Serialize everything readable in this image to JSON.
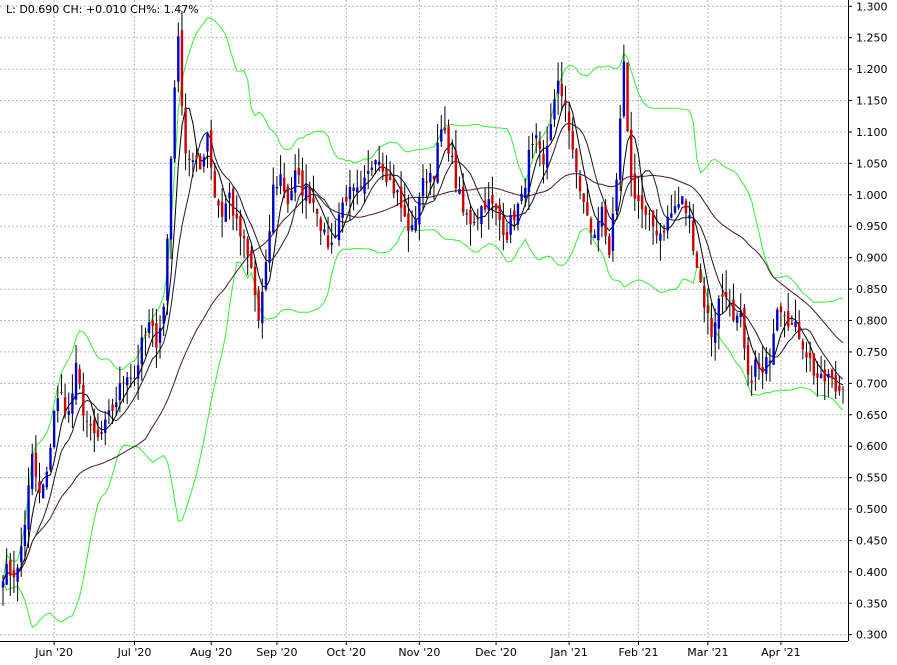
{
  "info_bar": {
    "text": "L: D0.690 CH: +0.010 CH%: 1.47%"
  },
  "colors": {
    "up": "#0000cc",
    "down": "#cc0000",
    "wick": "#000000",
    "bollinger": "#33ee33",
    "ma_short": "#000000",
    "ma_mid": "#1a1a3a",
    "ma_long": "#4a1535",
    "grid": "#b8b8b8",
    "frame": "#000000"
  },
  "chart_data": {
    "type": "candlestick",
    "title": "",
    "xlabel": "",
    "ylabel": "",
    "ylim": [
      0.29,
      1.31
    ],
    "y_ticks": [
      "0.300",
      "0.350",
      "0.400",
      "0.450",
      "0.500",
      "0.550",
      "0.600",
      "0.650",
      "0.700",
      "0.750",
      "0.800",
      "0.850",
      "0.900",
      "0.950",
      "1.000",
      "1.050",
      "1.100",
      "1.150",
      "1.200",
      "1.250",
      "1.300"
    ],
    "x_range": [
      0,
      230
    ],
    "x_ticks": [
      {
        "label": "Jun '20",
        "x": 14
      },
      {
        "label": "Jul '20",
        "x": 36
      },
      {
        "label": "Aug '20",
        "x": 57
      },
      {
        "label": "Sep '20",
        "x": 75
      },
      {
        "label": "Oct '20",
        "x": 94
      },
      {
        "label": "Nov '20",
        "x": 114
      },
      {
        "label": "Dec '20",
        "x": 135
      },
      {
        "label": "Jan '21",
        "x": 155
      },
      {
        "label": "Feb '21",
        "x": 174
      },
      {
        "label": "Mar '21",
        "x": 193
      },
      {
        "label": "Apr '21",
        "x": 213
      }
    ],
    "close_anchors": [
      [
        0,
        0.4
      ],
      [
        4,
        0.4
      ],
      [
        6,
        0.48
      ],
      [
        8,
        0.58
      ],
      [
        10,
        0.52
      ],
      [
        12,
        0.55
      ],
      [
        14,
        0.66
      ],
      [
        16,
        0.68
      ],
      [
        18,
        0.65
      ],
      [
        20,
        0.72
      ],
      [
        22,
        0.66
      ],
      [
        24,
        0.62
      ],
      [
        26,
        0.61
      ],
      [
        28,
        0.63
      ],
      [
        30,
        0.66
      ],
      [
        32,
        0.69
      ],
      [
        34,
        0.72
      ],
      [
        36,
        0.71
      ],
      [
        38,
        0.76
      ],
      [
        40,
        0.79
      ],
      [
        42,
        0.77
      ],
      [
        44,
        0.82
      ],
      [
        45,
        0.93
      ],
      [
        46,
        1.06
      ],
      [
        47,
        1.18
      ],
      [
        48,
        1.24
      ],
      [
        50,
        1.07
      ],
      [
        52,
        1.05
      ],
      [
        54,
        1.04
      ],
      [
        56,
        1.1
      ],
      [
        58,
        1.0
      ],
      [
        60,
        0.97
      ],
      [
        62,
        1.0
      ],
      [
        64,
        0.95
      ],
      [
        66,
        0.92
      ],
      [
        68,
        0.88
      ],
      [
        70,
        0.8
      ],
      [
        72,
        0.88
      ],
      [
        74,
        1.01
      ],
      [
        76,
        1.03
      ],
      [
        78,
        0.99
      ],
      [
        80,
        1.03
      ],
      [
        82,
        1.01
      ],
      [
        84,
        1.0
      ],
      [
        86,
        0.98
      ],
      [
        88,
        0.93
      ],
      [
        90,
        0.92
      ],
      [
        92,
        0.97
      ],
      [
        94,
        1.0
      ],
      [
        96,
        1.0
      ],
      [
        98,
        1.0
      ],
      [
        100,
        1.03
      ],
      [
        102,
        1.07
      ],
      [
        104,
        1.05
      ],
      [
        106,
        1.02
      ],
      [
        108,
        1.0
      ],
      [
        110,
        0.96
      ],
      [
        112,
        0.94
      ],
      [
        114,
        1.0
      ],
      [
        116,
        1.03
      ],
      [
        118,
        1.04
      ],
      [
        120,
        1.1
      ],
      [
        122,
        1.08
      ],
      [
        124,
        1.02
      ],
      [
        126,
        0.97
      ],
      [
        128,
        0.96
      ],
      [
        130,
        0.97
      ],
      [
        132,
        0.99
      ],
      [
        134,
        0.98
      ],
      [
        136,
        0.96
      ],
      [
        138,
        0.94
      ],
      [
        140,
        0.97
      ],
      [
        142,
        0.99
      ],
      [
        144,
        1.06
      ],
      [
        146,
        1.08
      ],
      [
        148,
        1.04
      ],
      [
        150,
        1.12
      ],
      [
        152,
        1.17
      ],
      [
        154,
        1.15
      ],
      [
        156,
        1.06
      ],
      [
        158,
        1.01
      ],
      [
        160,
        0.96
      ],
      [
        162,
        0.93
      ],
      [
        164,
        0.99
      ],
      [
        166,
        0.89
      ],
      [
        168,
        1.02
      ],
      [
        170,
        1.2
      ],
      [
        172,
        1.02
      ],
      [
        174,
        0.99
      ],
      [
        176,
        0.96
      ],
      [
        178,
        0.95
      ],
      [
        180,
        0.94
      ],
      [
        182,
        0.96
      ],
      [
        184,
        0.98
      ],
      [
        186,
        0.99
      ],
      [
        188,
        0.96
      ],
      [
        190,
        0.89
      ],
      [
        192,
        0.83
      ],
      [
        194,
        0.78
      ],
      [
        196,
        0.83
      ],
      [
        198,
        0.85
      ],
      [
        200,
        0.79
      ],
      [
        202,
        0.8
      ],
      [
        204,
        0.7
      ],
      [
        206,
        0.73
      ],
      [
        208,
        0.71
      ],
      [
        210,
        0.75
      ],
      [
        212,
        0.83
      ],
      [
        214,
        0.82
      ],
      [
        216,
        0.79
      ],
      [
        218,
        0.78
      ],
      [
        220,
        0.75
      ],
      [
        222,
        0.72
      ],
      [
        224,
        0.7
      ],
      [
        226,
        0.71
      ],
      [
        228,
        0.69
      ]
    ],
    "last_close": 0.69,
    "change": 0.01,
    "change_pct": 1.47
  }
}
